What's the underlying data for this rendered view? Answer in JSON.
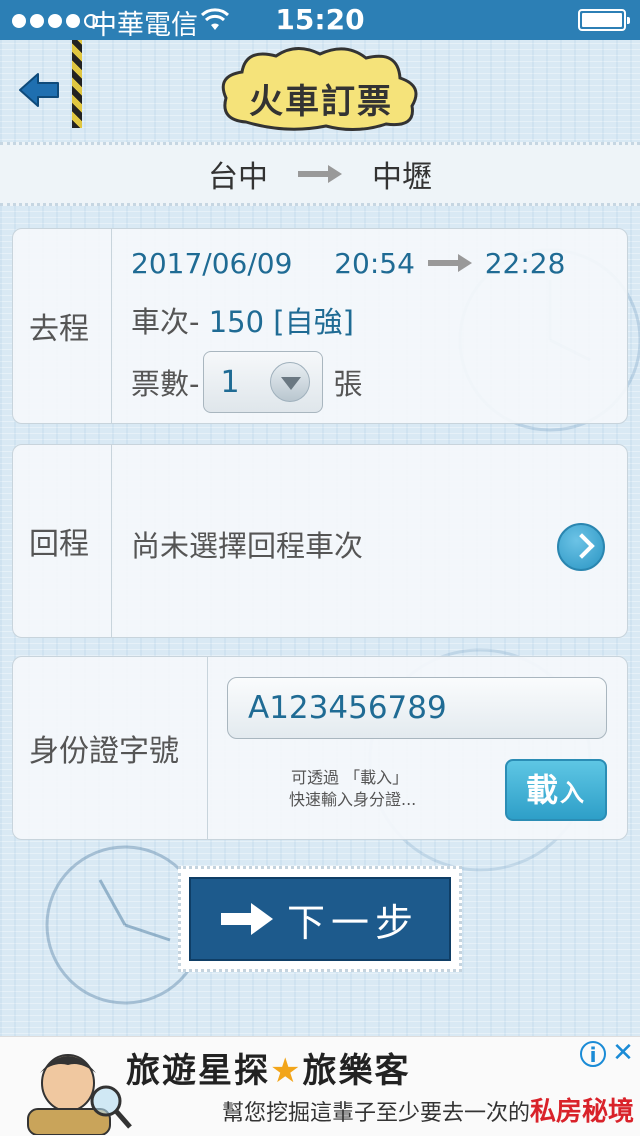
{
  "status_bar": {
    "carrier": "中華電信",
    "time": "15:20"
  },
  "header": {
    "title": "火車訂票"
  },
  "route": {
    "from": "台中",
    "to": "中壢"
  },
  "outbound": {
    "label": "去程",
    "date": "2017/06/09",
    "depart_time": "20:54",
    "arrive_time": "22:28",
    "train_prefix": "車次-",
    "train_no": "150",
    "train_type": "[自強]",
    "tickets_prefix": "票數-",
    "tickets_value": "1",
    "tickets_suffix": "張"
  },
  "return": {
    "label": "回程",
    "hint": "尚未選擇回程車次"
  },
  "id_section": {
    "label": "身份證字號",
    "value": "A123456789",
    "hint_line1": "可透過 「載入」",
    "hint_line2": "快速輸入身分證...",
    "load_label_big": "載",
    "load_label_small": "入"
  },
  "next": {
    "label": "下一步"
  },
  "ad": {
    "line1_a": "旅遊星探",
    "line1_star": "★",
    "line1_brand": "旅樂客",
    "line2_text": "幫您挖掘這輩子至少要去一次的",
    "line2_highlight": "私房秘境",
    "info": "i",
    "close": "✕"
  },
  "colors": {
    "status_bar": "#2c7fb5",
    "accent_blue": "#1f6b94",
    "next_button": "#1d5a8c",
    "load_button": "#2e9fc8"
  },
  "icons": {
    "back": "back-arrow-icon",
    "go": "chevron-right-icon",
    "next": "right-arrow-icon",
    "wifi": "wifi-icon",
    "battery": "battery-icon"
  }
}
